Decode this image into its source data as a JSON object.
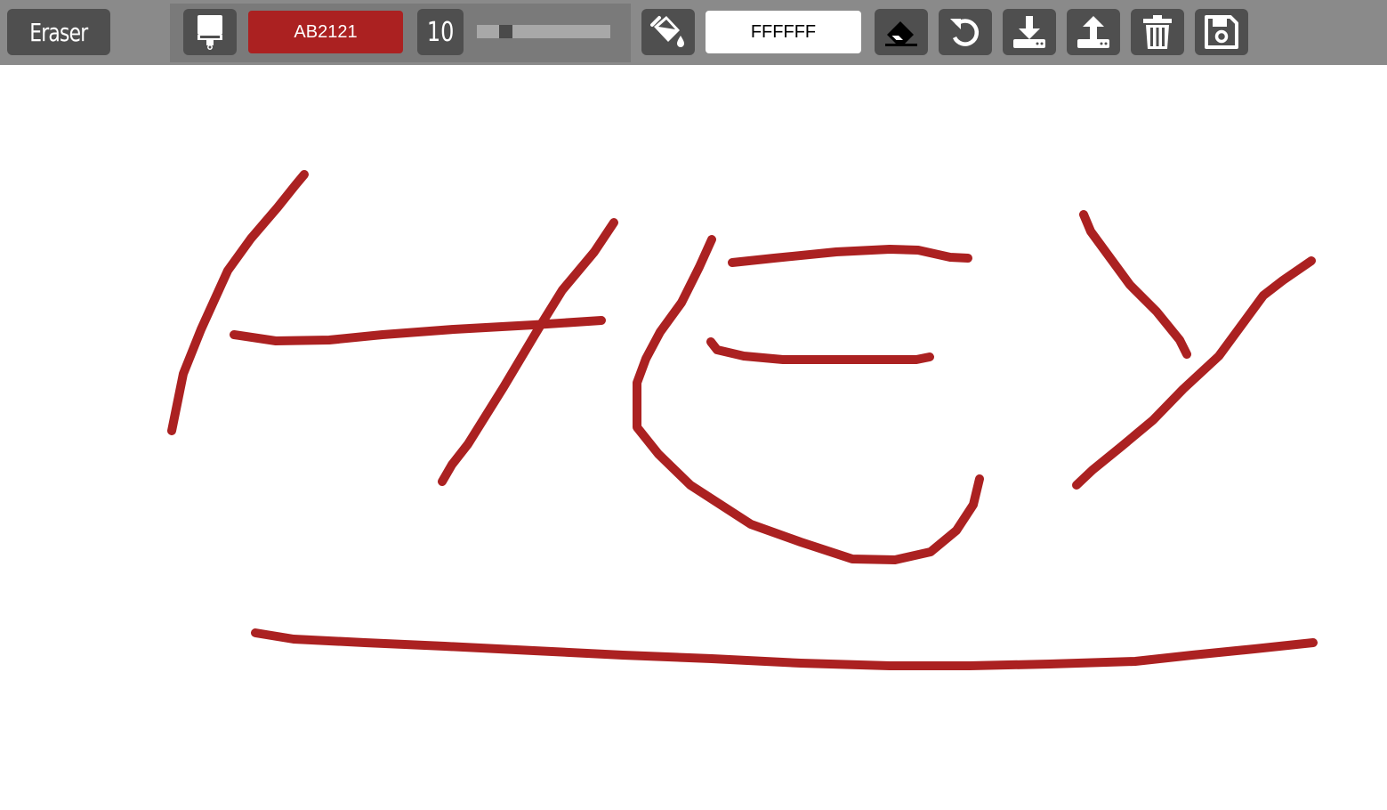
{
  "toolbar": {
    "mode_label": "Eraser",
    "brush_color_label": "AB2121",
    "brush_color": "#AB2121",
    "brush_size": "10",
    "size_slider_fraction": 0.18,
    "fill_color_label": "FFFFFF",
    "fill_color": "#FFFFFF",
    "icons": {
      "brush": "paint-brush-icon",
      "fill": "fill-bucket-icon",
      "eraser": "eraser-icon",
      "undo": "undo-icon",
      "download": "download-icon",
      "upload": "upload-icon",
      "clear": "trash-icon",
      "save": "save-icon"
    }
  },
  "canvas": {
    "background": "#FFFFFF",
    "stroke_color": "#AB2121",
    "stroke_width": 10
  }
}
